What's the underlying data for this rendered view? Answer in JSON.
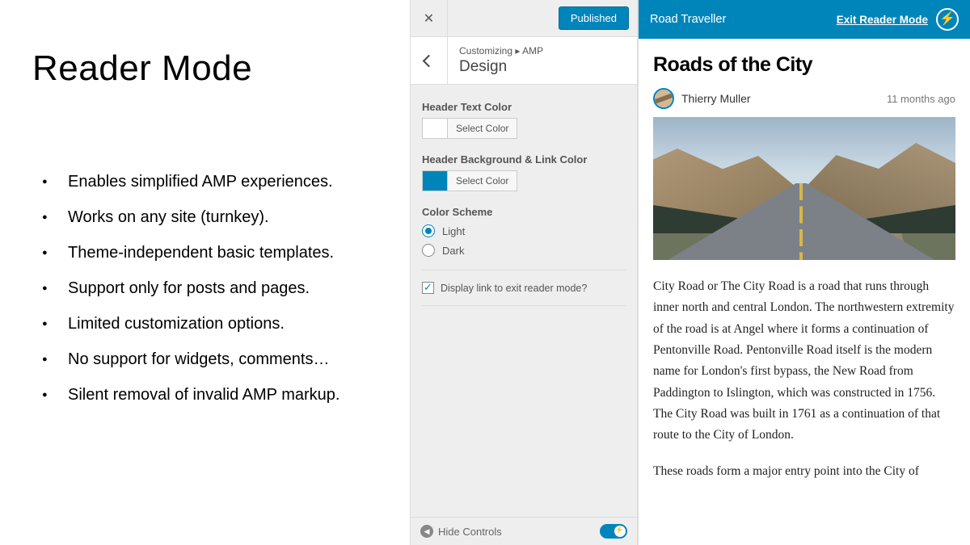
{
  "slide": {
    "title": "Reader Mode",
    "bullets": [
      "Enables simplified AMP experiences.",
      "Works on any site (turnkey).",
      "Theme-independent basic templates.",
      "Support only for posts and pages.",
      "Limited customization options.",
      "No support for widgets, comments…",
      "Silent removal of invalid AMP markup."
    ]
  },
  "customizer": {
    "published_label": "Published",
    "breadcrumb_parent": "Customizing",
    "breadcrumb_separator": "▸",
    "breadcrumb_context": "AMP",
    "section_title": "Design",
    "controls": {
      "header_text_color": {
        "label": "Header Text Color",
        "button": "Select Color",
        "swatch": "#ffffff"
      },
      "header_bg_link_color": {
        "label": "Header Background & Link Color",
        "button": "Select Color",
        "swatch": "#0085ba"
      },
      "color_scheme": {
        "label": "Color Scheme",
        "options": [
          "Light",
          "Dark"
        ],
        "selected": "Light"
      },
      "exit_link": {
        "label": "Display link to exit reader mode?",
        "checked": true
      }
    },
    "footer": {
      "hide_controls": "Hide Controls"
    }
  },
  "preview": {
    "site_title": "Road Traveller",
    "exit_label": "Exit Reader Mode",
    "post_title": "Roads of the City",
    "author": "Thierry Muller",
    "date": "11 months ago",
    "body": {
      "p1": "City Road or The City Road is a road that runs through inner north and central London. The northwestern extremity of the road is at Angel where it forms a continuation of Pentonville Road. Pentonville Road itself is the modern name for London's first bypass, the New Road from Paddington to Islington, which was constructed in 1756. The City Road was built in 1761 as a continuation of that route to the City of London.",
      "p2": "These roads form a major entry point into the City of"
    }
  }
}
